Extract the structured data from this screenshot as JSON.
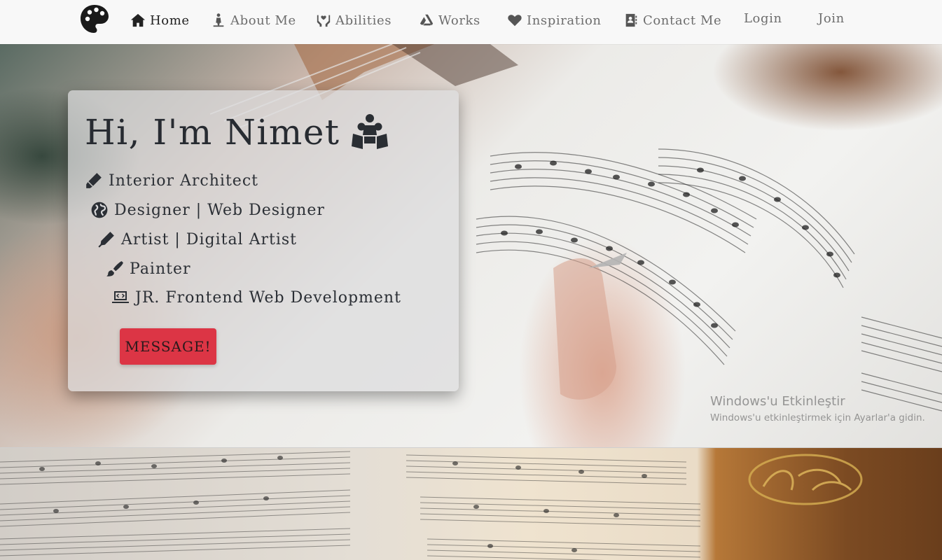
{
  "nav": {
    "items": [
      {
        "label": "Home",
        "icon": "home-icon"
      },
      {
        "label": "About Me",
        "icon": "person-icon"
      },
      {
        "label": "Abilities",
        "icon": "hands-heart-icon"
      },
      {
        "label": "Works",
        "icon": "artstation-icon"
      },
      {
        "label": "Inspiration",
        "icon": "heart-icon"
      },
      {
        "label": "Contact Me",
        "icon": "address-book-icon"
      }
    ],
    "login_label": "Login",
    "join_label": "Join",
    "logo_icon": "palette-icon"
  },
  "hero": {
    "title": "Hi, I'm Nimet",
    "title_icon": "people-group-icon",
    "roles": [
      {
        "label": "Interior Architect",
        "icon": "marker-icon"
      },
      {
        "label": "Designer | Web Designer",
        "icon": "globe-icon"
      },
      {
        "label": "Artist | Digital Artist",
        "icon": "pen-icon"
      },
      {
        "label": "Painter",
        "icon": "paintbrush-icon"
      },
      {
        "label": "JR. Frontend Web Development",
        "icon": "laptop-code-icon"
      }
    ],
    "button_label": "MESSAGE!"
  },
  "watermark": {
    "title": "Windows'u Etkinleştir",
    "subtitle": "Windows'u etkinleştirmek için Ayarlar'a gidin."
  },
  "colors": {
    "accent": "#dc3545",
    "nav_bg": "#f8f8f8",
    "text_dark": "#272b31"
  }
}
